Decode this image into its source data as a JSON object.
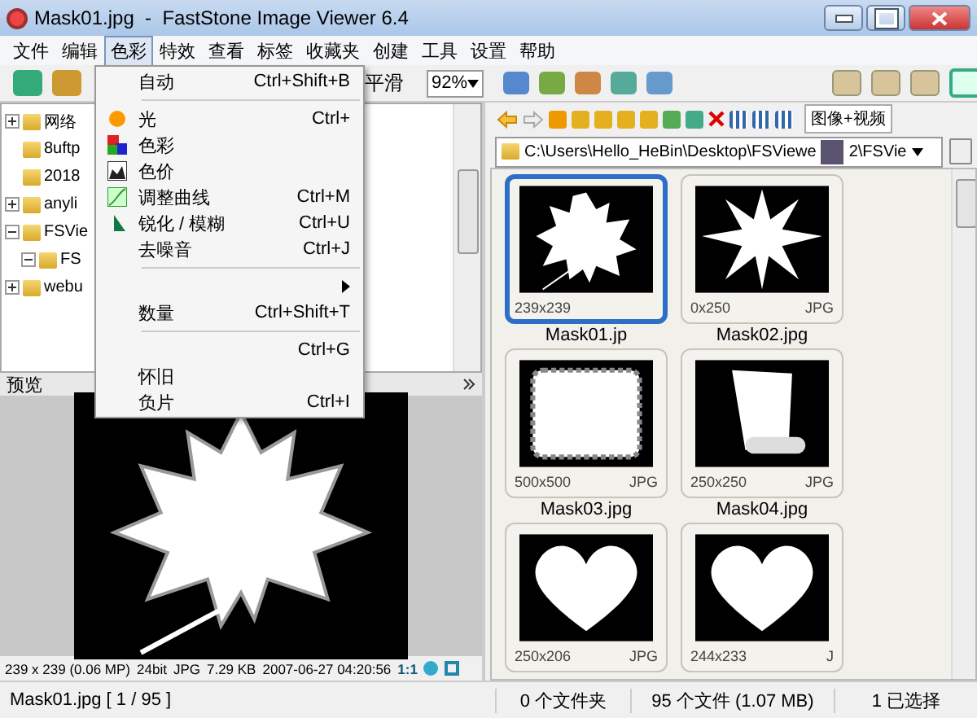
{
  "window": {
    "title": "Mask01.jpg  -  FastStone Image Viewer 6.4"
  },
  "menu_bar": [
    {
      "label": "文件",
      "selected": false
    },
    {
      "label": "编辑",
      "selected": false
    },
    {
      "label": "色彩",
      "selected": true
    },
    {
      "label": "特效",
      "selected": false
    },
    {
      "label": "查看",
      "selected": false
    },
    {
      "label": "标签",
      "selected": false
    },
    {
      "label": "收藏夹",
      "selected": false
    },
    {
      "label": "创建",
      "selected": false
    },
    {
      "label": "工具",
      "selected": false
    },
    {
      "label": "设置",
      "selected": false
    },
    {
      "label": "帮助",
      "selected": false
    }
  ],
  "toolbar": {
    "smooth_label": "平滑",
    "zoom": "92%"
  },
  "color_menu": [
    {
      "kind": "item",
      "label": "自动",
      "shortcut": "Ctrl+Shift+B",
      "submenu": false
    },
    {
      "kind": "separator"
    },
    {
      "kind": "item",
      "label": "光",
      "shortcut": "Ctrl+",
      "submenu": false
    },
    {
      "kind": "item",
      "label": "色彩",
      "submenu": false
    },
    {
      "kind": "item",
      "label": "色价",
      "submenu": false
    },
    {
      "kind": "item",
      "label": "调整曲线",
      "shortcut": "Ctrl+M",
      "submenu": false
    },
    {
      "kind": "item",
      "label": "锐化 / 模糊",
      "shortcut": "Ctrl+U",
      "submenu": false
    },
    {
      "kind": "item",
      "label": "去噪音",
      "shortcut": "Ctrl+J",
      "submenu": false
    },
    {
      "kind": "separator"
    },
    {
      "kind": "item",
      "submenu": true
    },
    {
      "kind": "item",
      "label": "数量",
      "shortcut": "Ctrl+Shift+T",
      "submenu": false
    },
    {
      "kind": "separator"
    },
    {
      "kind": "item",
      "shortcut": "Ctrl+G",
      "submenu": false
    },
    {
      "kind": "item",
      "label": "怀旧",
      "submenu": false
    },
    {
      "kind": "item",
      "label": "负片",
      "shortcut": "Ctrl+I",
      "submenu": false
    }
  ],
  "folder_tree": [
    {
      "label": "网络",
      "kind": "branch",
      "expanded": false
    },
    {
      "label": "8uftp",
      "kind": "leaf"
    },
    {
      "label": "2018",
      "kind": "leaf"
    },
    {
      "label": "anyli",
      "kind": "branch",
      "expanded": false
    },
    {
      "label": "FSVie",
      "kind": "branch",
      "expanded": true,
      "children": [
        {
          "label": "FS",
          "kind": "branch",
          "expanded": true
        }
      ]
    },
    {
      "label": "webu",
      "kind": "branch",
      "expanded": false
    }
  ],
  "preview": {
    "title": "预览"
  },
  "image_info": {
    "size": "239 x 239 (0.06 MP)",
    "depth": "24bit",
    "format": "JPG",
    "file_size": "7.29 KB",
    "date": "2007-06-27 04:20:56",
    "ratio": "1:1"
  },
  "browser": {
    "filter": "图像+视频",
    "path": [
      "C:\\Users\\Hello_HeBin\\Desktop\\FSViewe",
      "2\\FSVie"
    ]
  },
  "thumbnails": [
    {
      "name": "Mask01.jp",
      "dims": "239x239",
      "selected": true
    },
    {
      "name": "Mask02.jpg",
      "dims": "0x250",
      "format": "JPG",
      "selected": false
    },
    {
      "name": "Mask03.jpg",
      "dims": "500x500",
      "format": "JPG",
      "selected": false
    },
    {
      "name": "Mask04.jpg",
      "dims": "250x250",
      "format": "JPG",
      "selected": false
    },
    {
      "dims": "250x206",
      "format": "JPG",
      "selected": false
    },
    {
      "dims": "244x233",
      "format": "J",
      "selected": false
    }
  ],
  "status_bar": {
    "file": "Mask01.jpg [ 1 / 95 ]",
    "folders": "0 个文件夹",
    "files": "95 个文件 (1.07 MB)",
    "selected": "1 已选择"
  }
}
